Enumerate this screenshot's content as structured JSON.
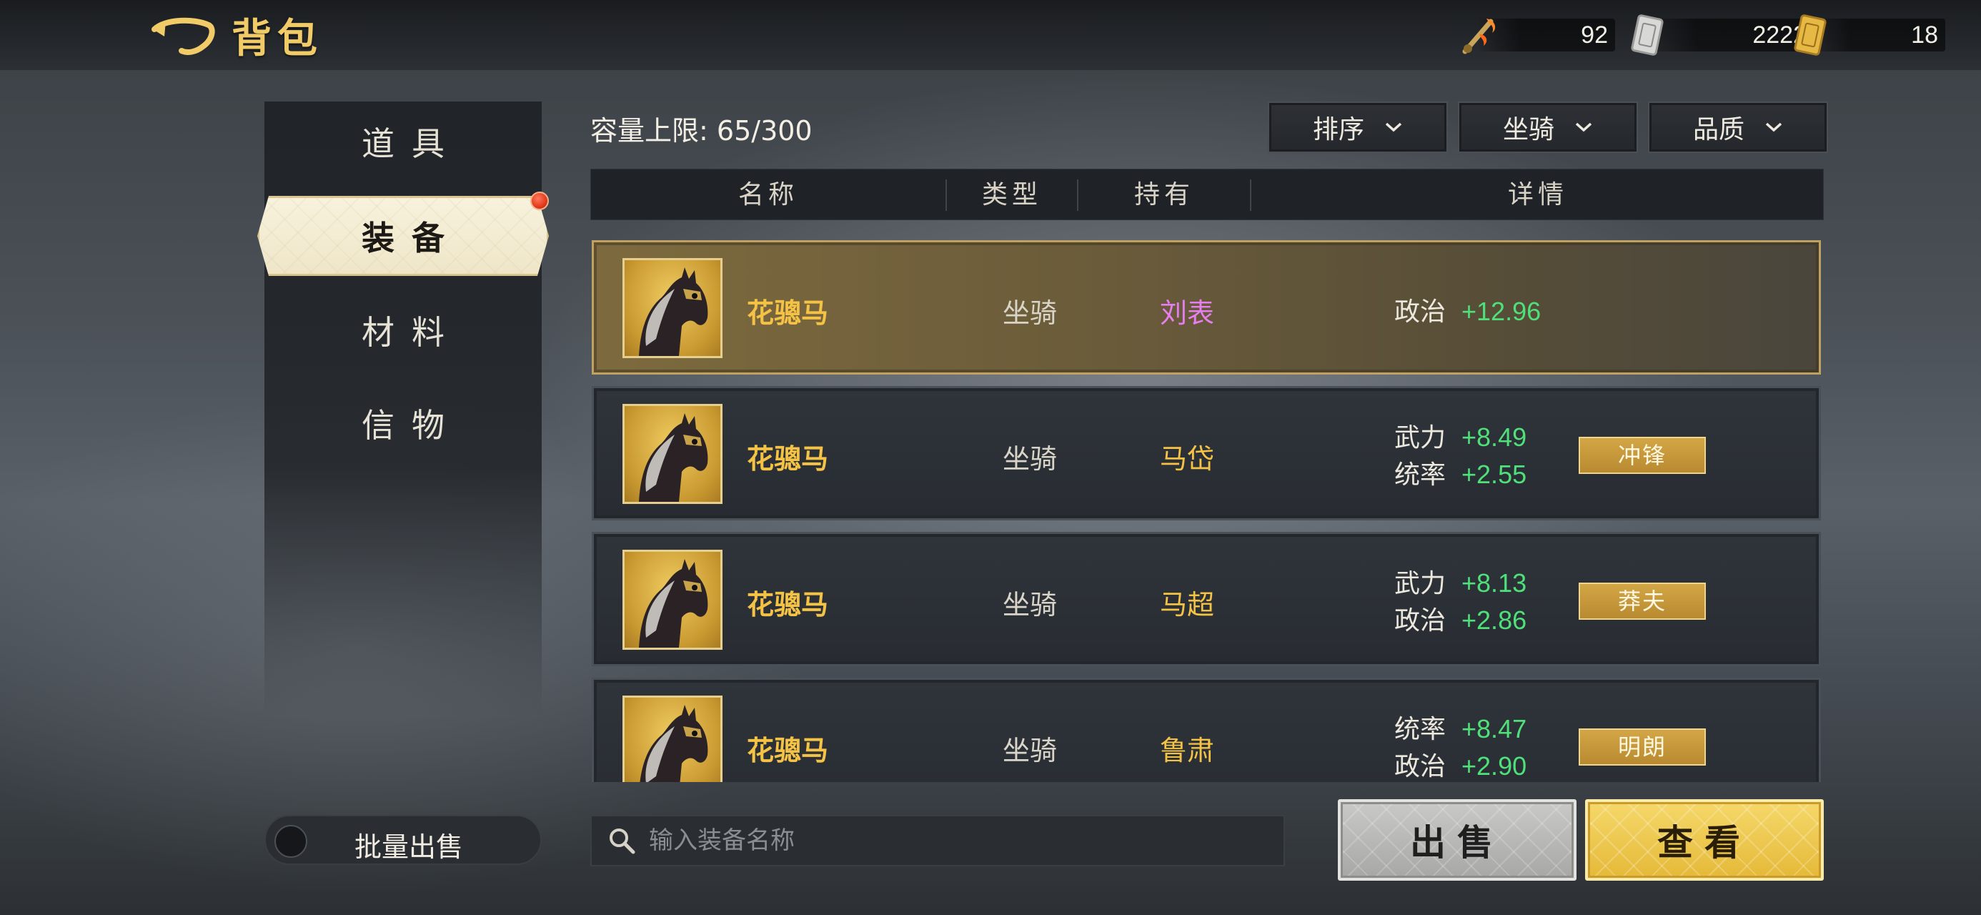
{
  "header": {
    "title": "背包",
    "currencies": [
      {
        "icon": "fire-sword-icon",
        "value": "92"
      },
      {
        "icon": "silver-token-icon",
        "value": "2222"
      },
      {
        "icon": "gold-token-icon",
        "value": "18"
      }
    ]
  },
  "sidebar": {
    "items": [
      {
        "label": "道具",
        "active": false
      },
      {
        "label": "装备",
        "active": true,
        "badge": true
      },
      {
        "label": "材料",
        "active": false
      },
      {
        "label": "信物",
        "active": false
      }
    ]
  },
  "toolbar": {
    "capacity_label": "容量上限:",
    "capacity_value": "65/300",
    "filters": [
      {
        "label": "排序"
      },
      {
        "label": "坐骑"
      },
      {
        "label": "品质"
      }
    ]
  },
  "table": {
    "columns": [
      "名称",
      "类型",
      "持有",
      "详情"
    ],
    "rows": [
      {
        "name": "花骢马",
        "type": "坐骑",
        "owner": "刘表",
        "owner_color": "#e77ef0",
        "stats": [
          {
            "k": "政治",
            "v": "+12.96"
          }
        ],
        "tag": "",
        "selected": true
      },
      {
        "name": "花骢马",
        "type": "坐骑",
        "owner": "马岱",
        "owner_color": "#f4c244",
        "stats": [
          {
            "k": "武力",
            "v": "+8.49"
          },
          {
            "k": "统率",
            "v": "+2.55"
          }
        ],
        "tag": "冲锋",
        "selected": false
      },
      {
        "name": "花骢马",
        "type": "坐骑",
        "owner": "马超",
        "owner_color": "#f4c244",
        "stats": [
          {
            "k": "武力",
            "v": "+8.13"
          },
          {
            "k": "政治",
            "v": "+2.86"
          }
        ],
        "tag": "莽夫",
        "selected": false
      },
      {
        "name": "花骢马",
        "type": "坐骑",
        "owner": "鲁肃",
        "owner_color": "#f4c244",
        "stats": [
          {
            "k": "统率",
            "v": "+8.47"
          },
          {
            "k": "政治",
            "v": "+2.90"
          }
        ],
        "tag": "明朗",
        "selected": false
      }
    ]
  },
  "footer": {
    "batch_sell_label": "批量出售",
    "search_placeholder": "输入装备名称",
    "sell_label": "出售",
    "view_label": "查看"
  }
}
